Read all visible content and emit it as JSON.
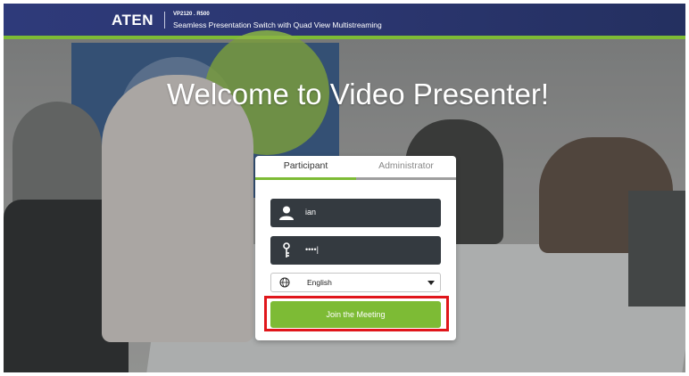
{
  "header": {
    "logo": "ATEN",
    "model": "VP2120 . R500",
    "subtitle": "Seamless Presentation Switch with Quad View Multistreaming"
  },
  "welcome": "Welcome to Video Presenter!",
  "tabs": [
    {
      "label": "Participant",
      "active": true
    },
    {
      "label": "Administrator",
      "active": false
    }
  ],
  "form": {
    "username": {
      "icon": "user-icon",
      "value": "ian"
    },
    "password": {
      "icon": "key-icon",
      "value": "••••|"
    },
    "language": {
      "icon": "globe-icon",
      "selected": "English"
    },
    "join_label": "Join the Meeting"
  },
  "colors": {
    "header": "#2b3670",
    "accent": "#7dbb35",
    "field": "#343a40",
    "highlight": "#e0161b"
  }
}
